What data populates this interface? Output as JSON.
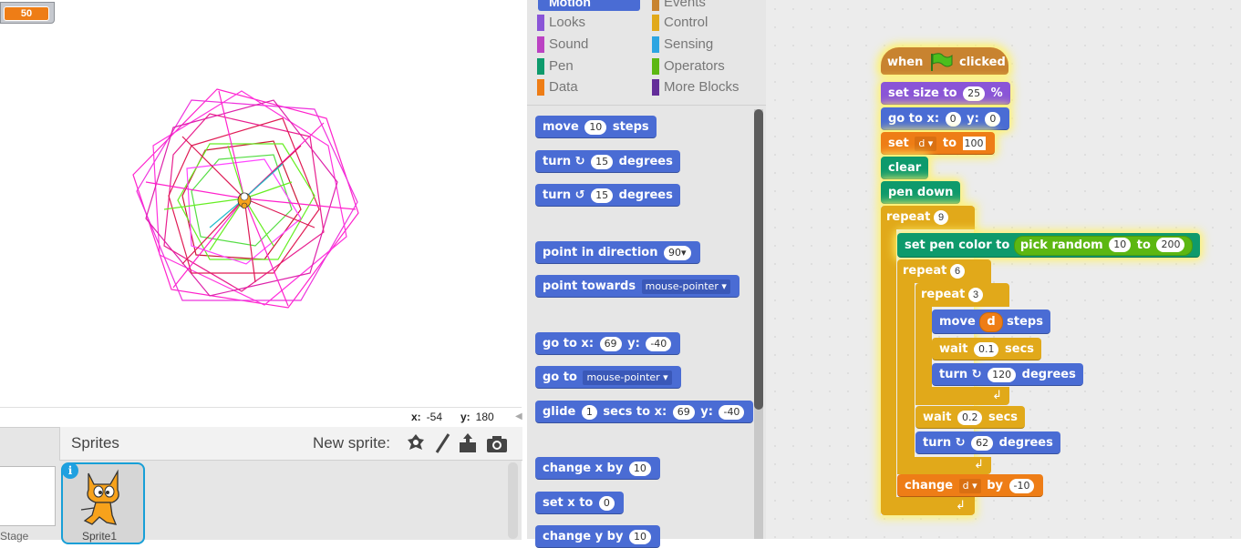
{
  "stage": {
    "variable_monitor_value": "50",
    "coords_x_label": "x:",
    "coords_x_value": "-54",
    "coords_y_label": "y:",
    "coords_y_value": "180"
  },
  "sprite_pane": {
    "title": "Sprites",
    "new_sprite_label": "New sprite:",
    "stage_label": "Stage",
    "sprite_label": "Sprite1",
    "info_label": "i"
  },
  "categories": {
    "motion": "Motion",
    "events": "Events",
    "looks": "Looks",
    "control": "Control",
    "sound": "Sound",
    "sensing": "Sensing",
    "pen": "Pen",
    "operators": "Operators",
    "data": "Data",
    "more_blocks": "More Blocks"
  },
  "palette": {
    "move": {
      "a": "move",
      "v": "10",
      "b": "steps"
    },
    "turn_cw": {
      "a": "turn",
      "v": "15",
      "b": "degrees"
    },
    "turn_ccw": {
      "a": "turn",
      "v": "15",
      "b": "degrees"
    },
    "point_dir": {
      "a": "point in direction",
      "v": "90"
    },
    "point_towards": {
      "a": "point towards",
      "v": "mouse-pointer"
    },
    "goto_xy": {
      "a": "go to x:",
      "x": "69",
      "b": "y:",
      "y": "-40"
    },
    "goto": {
      "a": "go to",
      "v": "mouse-pointer"
    },
    "glide": {
      "a": "glide",
      "s": "1",
      "b": "secs to x:",
      "x": "69",
      "c": "y:",
      "y": "-40"
    },
    "change_x": {
      "a": "change x by",
      "v": "10"
    },
    "set_x": {
      "a": "set x to",
      "v": "0"
    },
    "change_y": {
      "a": "change y by",
      "v": "10"
    }
  },
  "script": {
    "hat": {
      "a": "when",
      "b": "clicked"
    },
    "set_size": {
      "a": "set size to",
      "v": "25",
      "b": "%"
    },
    "go_to": {
      "a": "go to x:",
      "x": "0",
      "b": "y:",
      "y": "0"
    },
    "set_var": {
      "a": "set",
      "var": "d",
      "b": "to",
      "v": "100"
    },
    "clear": "clear",
    "pen_down": "pen down",
    "repeat1": {
      "a": "repeat",
      "v": "9"
    },
    "set_pen_color": {
      "a": "set pen color to",
      "r": "pick random",
      "lo": "10",
      "to": "to",
      "hi": "200"
    },
    "repeat2": {
      "a": "repeat",
      "v": "6"
    },
    "repeat3": {
      "a": "repeat",
      "v": "3"
    },
    "move": {
      "a": "move",
      "var": "d",
      "b": "steps"
    },
    "wait1": {
      "a": "wait",
      "v": "0.1",
      "b": "secs"
    },
    "turn1": {
      "a": "turn",
      "v": "120",
      "b": "degrees"
    },
    "wait2": {
      "a": "wait",
      "v": "0.2",
      "b": "secs"
    },
    "turn2": {
      "a": "turn",
      "v": "62",
      "b": "degrees"
    },
    "change_var": {
      "a": "change",
      "var": "d",
      "b": "by",
      "v": "-10"
    }
  },
  "colors": {
    "motion": "#4a6cd4",
    "looks": "#8a55d7",
    "pen": "#0e9a6c",
    "data": "#ee7d16",
    "control": "#e1a91a",
    "events": "#c88330",
    "operators": "#5cb712",
    "sound": "#bb42c3",
    "sensing": "#2ca5e2",
    "more_blocks": "#632d99"
  }
}
